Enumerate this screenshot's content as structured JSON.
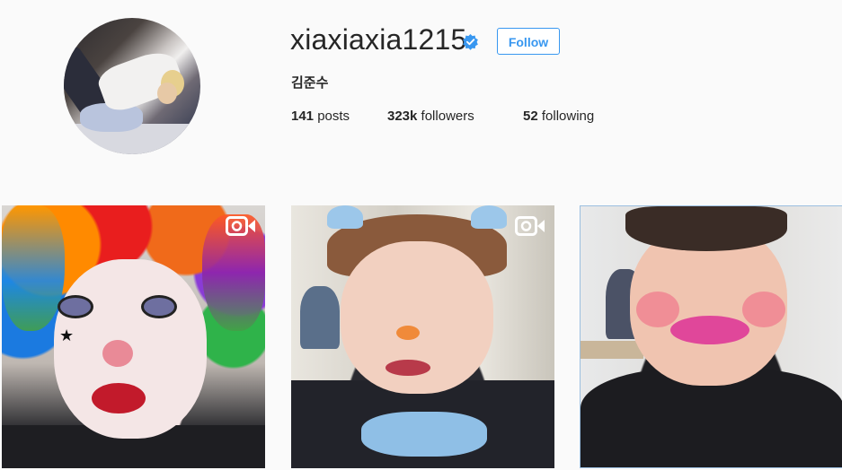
{
  "profile": {
    "username": "xiaxiaxia1215",
    "verified": true,
    "follow_label": "Follow",
    "full_name": "김준수",
    "stats": {
      "posts_count": "141",
      "posts_label": "posts",
      "followers_count": "323k",
      "followers_label": "followers",
      "following_count": "52",
      "following_label": "following"
    }
  },
  "posts": [
    {
      "type": "video",
      "icon": "video-icon"
    },
    {
      "type": "video",
      "icon": "video-icon"
    },
    {
      "type": "photo",
      "icon": ""
    }
  ],
  "colors": {
    "accent": "#3897f0",
    "verified_badge": "#3897f0",
    "background": "#fafafa",
    "text": "#262626"
  }
}
